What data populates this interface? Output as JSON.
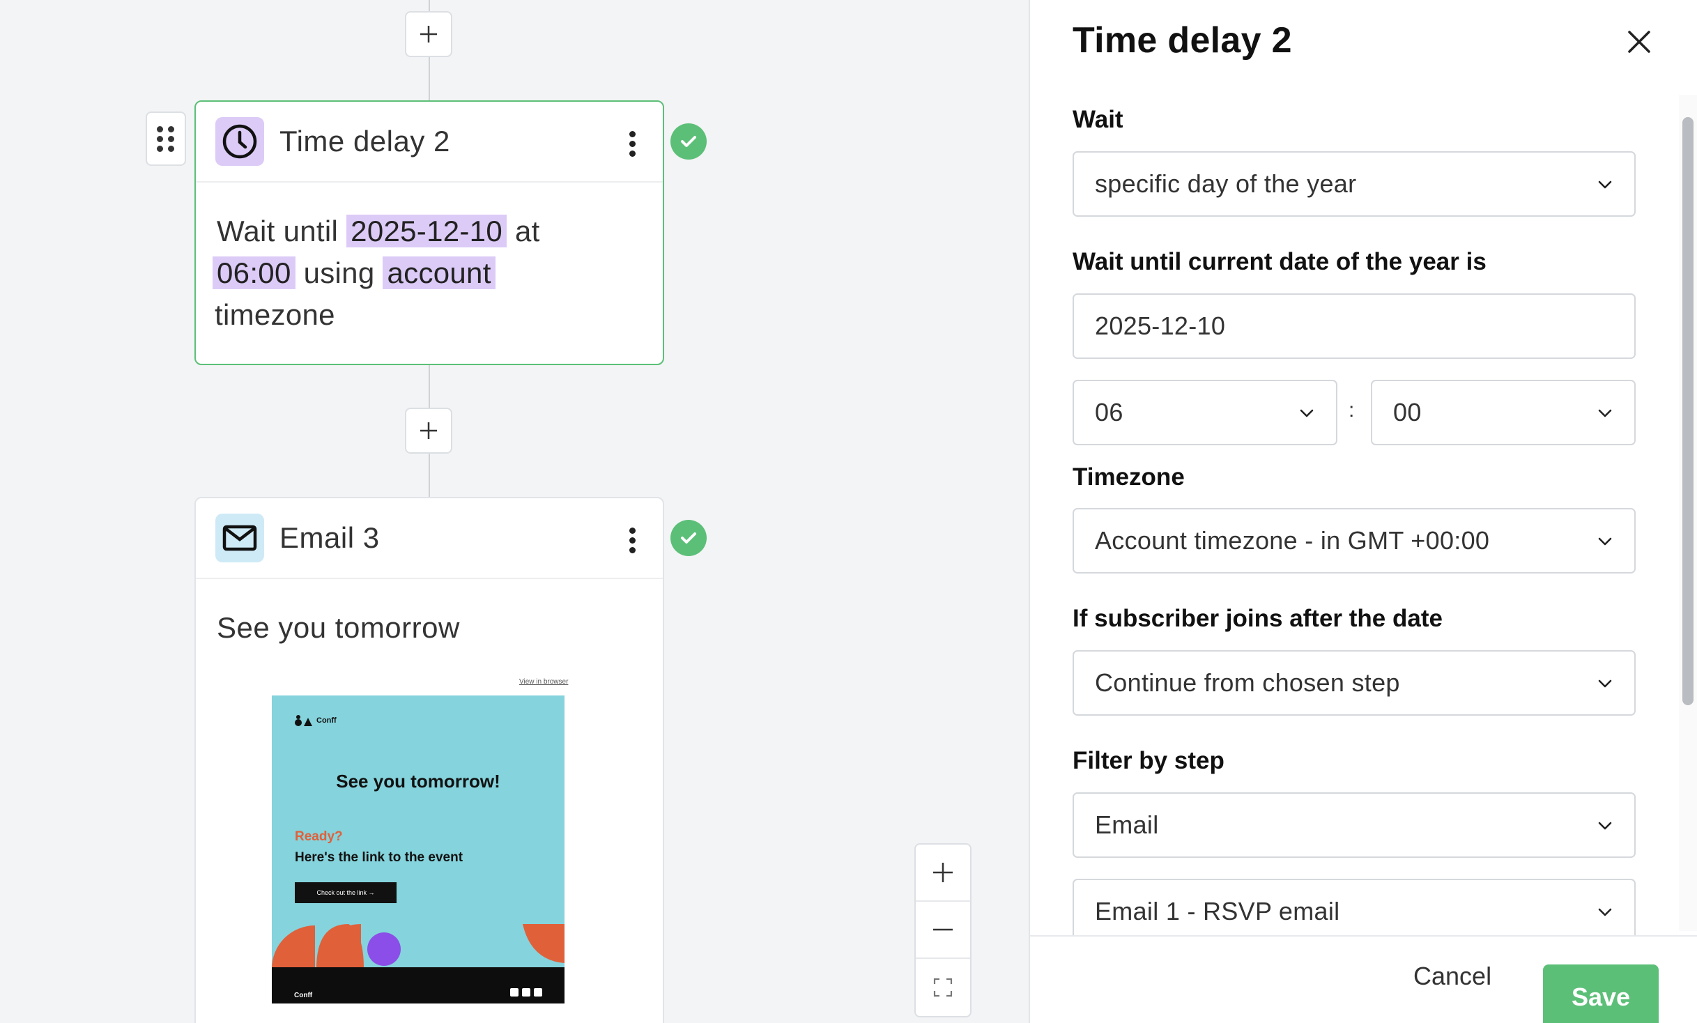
{
  "canvas": {
    "time_delay_node": {
      "title": "Time delay 2",
      "text_wait_until": "Wait until",
      "date": "2025-12-10",
      "text_at": "at",
      "time": "06:00",
      "text_using": "using",
      "timezone_source": "account",
      "text_timezone": "timezone"
    },
    "email_node": {
      "title": "Email 3",
      "subject": "See you tomorrow",
      "preview": {
        "view_in_browser": "View in browser",
        "logo_text": "Conff",
        "headline": "See you tomorrow!",
        "ready": "Ready?",
        "subline": "Here's the link to the event",
        "button": "Check out the link →",
        "footer_logo": "Conff"
      }
    }
  },
  "panel": {
    "title": "Time delay 2",
    "wait_label": "Wait",
    "wait_value": "specific day of the year",
    "date_label": "Wait until current date of the year is",
    "date_value": "2025-12-10",
    "hour_value": "06",
    "minute_value": "00",
    "colon": ":",
    "timezone_label": "Timezone",
    "timezone_value": "Account timezone - in GMT +00:00",
    "joins_after_label": "If subscriber joins after the date",
    "joins_after_value": "Continue from chosen step",
    "filter_label": "Filter by step",
    "filter_type_value": "Email",
    "filter_step_value": "Email 1 - RSVP email",
    "cancel_label": "Cancel",
    "save_label": "Save"
  },
  "colors": {
    "accent_green": "#5cbf78",
    "highlight_purple": "#dccbf7",
    "time_icon_bg": "#dccbf7",
    "email_icon_bg": "#cfeaf7",
    "preview_bg": "#85d3dc",
    "preview_orange": "#e0603a",
    "preview_purple": "#8b4ee8"
  },
  "icons": {
    "time_node": "clock-icon",
    "email_node": "envelope-icon",
    "status": "check-circle-icon",
    "menu": "kebab-icon",
    "drag": "drag-handle-icon",
    "add": "plus-icon",
    "zoom_in": "plus-icon",
    "zoom_out": "minus-icon",
    "fit": "fit-screen-icon",
    "close": "close-icon",
    "dropdown": "chevron-down-icon"
  }
}
